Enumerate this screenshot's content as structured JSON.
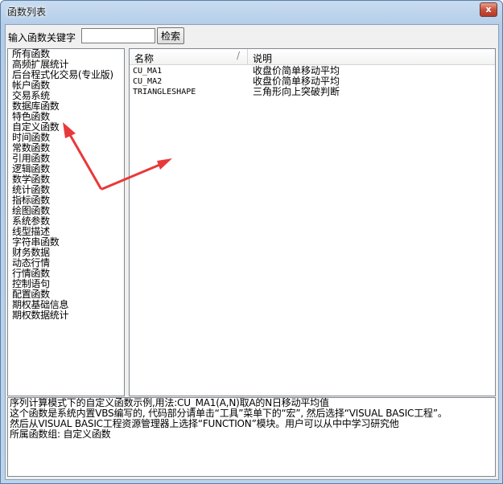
{
  "window": {
    "title": "函数列表",
    "close_glyph": "x"
  },
  "search": {
    "label": "输入函数关键字",
    "value": "",
    "placeholder": "",
    "button_label": "检索"
  },
  "categories": [
    "所有函数",
    "高频扩展统计",
    "后台程式化交易(专业版)",
    "帐户函数",
    "交易系统",
    "数据库函数",
    "特色函数",
    "自定义函数",
    "时间函数",
    "常数函数",
    "引用函数",
    "逻辑函数",
    "数学函数",
    "统计函数",
    "指标函数",
    "绘图函数",
    "系统参数",
    "线型描述",
    "字符串函数",
    "财务数据",
    "动态行情",
    "行情函数",
    "控制语句",
    "配置函数",
    "期权基础信息",
    "期权数据统计"
  ],
  "columns": {
    "name": "名称",
    "separator": "/",
    "description": "说明"
  },
  "functions": [
    {
      "name": "CU_MA1",
      "description": "收盘价简单移动平均"
    },
    {
      "name": "CU_MA2",
      "description": "收盘价简单移动平均"
    },
    {
      "name": "TRIANGLESHAPE",
      "description": "三角形向上突破判断"
    }
  ],
  "description_lines": [
    "序列计算模式下的自定义函数示例,用法:CU_MA1(A,N)取A的N日移动平均值",
    "  这个函数是系统内置VBS编写的, 代码部分请单击“工具”菜单下的“宏”, 然后选择“VISUAL BASIC工程”。",
    "然后从VISUAL BASIC工程资源管理器上选择“FUNCTION”模块。用户可以从中中学习研究他",
    "所属函数组: 自定义函数"
  ],
  "colors": {
    "arrow": "#e8393a",
    "title_bar": "#b9d1ea",
    "close_button": "#c8523a"
  }
}
